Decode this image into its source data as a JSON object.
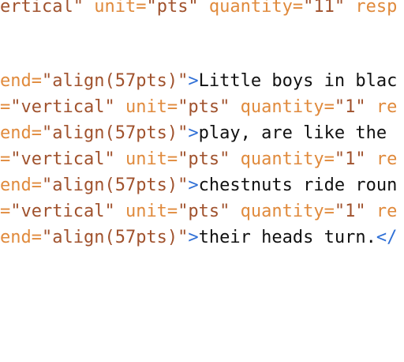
{
  "colors": {
    "attribute": "#e08a3c",
    "value": "#a0522d",
    "tag": "#2e6fd6",
    "text": "#111111",
    "background": "#ffffff"
  },
  "lines": [
    {
      "segments": [
        {
          "type": "val",
          "text": "ertical\""
        },
        {
          "type": "attr",
          "text": " unit="
        },
        {
          "type": "val",
          "text": "\"pts\""
        },
        {
          "type": "attr",
          "text": " quantity="
        },
        {
          "type": "val",
          "text": "\"11\""
        },
        {
          "type": "attr",
          "text": " resp"
        }
      ]
    },
    {
      "segments": [
        {
          "type": "attr",
          "text": "end="
        },
        {
          "type": "val",
          "text": "\"align(57pts)\""
        },
        {
          "type": "tag",
          "text": ">"
        },
        {
          "type": "txt",
          "text": "Little boys in blac"
        }
      ]
    },
    {
      "segments": [
        {
          "type": "attr",
          "text": "="
        },
        {
          "type": "val",
          "text": "\"vertical\""
        },
        {
          "type": "attr",
          "text": " unit="
        },
        {
          "type": "val",
          "text": "\"pts\""
        },
        {
          "type": "attr",
          "text": " quantity="
        },
        {
          "type": "val",
          "text": "\"1\""
        },
        {
          "type": "attr",
          "text": " re"
        }
      ]
    },
    {
      "segments": [
        {
          "type": "attr",
          "text": "end="
        },
        {
          "type": "val",
          "text": "\"align(57pts)\""
        },
        {
          "type": "tag",
          "text": ">"
        },
        {
          "type": "txt",
          "text": "play, are like the "
        }
      ]
    },
    {
      "segments": [
        {
          "type": "attr",
          "text": "="
        },
        {
          "type": "val",
          "text": "\"vertical\""
        },
        {
          "type": "attr",
          "text": " unit="
        },
        {
          "type": "val",
          "text": "\"pts\""
        },
        {
          "type": "attr",
          "text": " quantity="
        },
        {
          "type": "val",
          "text": "\"1\""
        },
        {
          "type": "attr",
          "text": " re"
        }
      ]
    },
    {
      "segments": [
        {
          "type": "attr",
          "text": "end="
        },
        {
          "type": "val",
          "text": "\"align(57pts)\""
        },
        {
          "type": "tag",
          "text": ">"
        },
        {
          "type": "txt",
          "text": "chestnuts ride roun"
        }
      ]
    },
    {
      "segments": [
        {
          "type": "attr",
          "text": "="
        },
        {
          "type": "val",
          "text": "\"vertical\""
        },
        {
          "type": "attr",
          "text": " unit="
        },
        {
          "type": "val",
          "text": "\"pts\""
        },
        {
          "type": "attr",
          "text": " quantity="
        },
        {
          "type": "val",
          "text": "\"1\""
        },
        {
          "type": "attr",
          "text": " re"
        }
      ]
    },
    {
      "segments": [
        {
          "type": "attr",
          "text": "end="
        },
        {
          "type": "val",
          "text": "\"align(57pts)\""
        },
        {
          "type": "tag",
          "text": ">"
        },
        {
          "type": "txt",
          "text": "their heads turn."
        },
        {
          "type": "tag",
          "text": "</"
        }
      ]
    }
  ]
}
